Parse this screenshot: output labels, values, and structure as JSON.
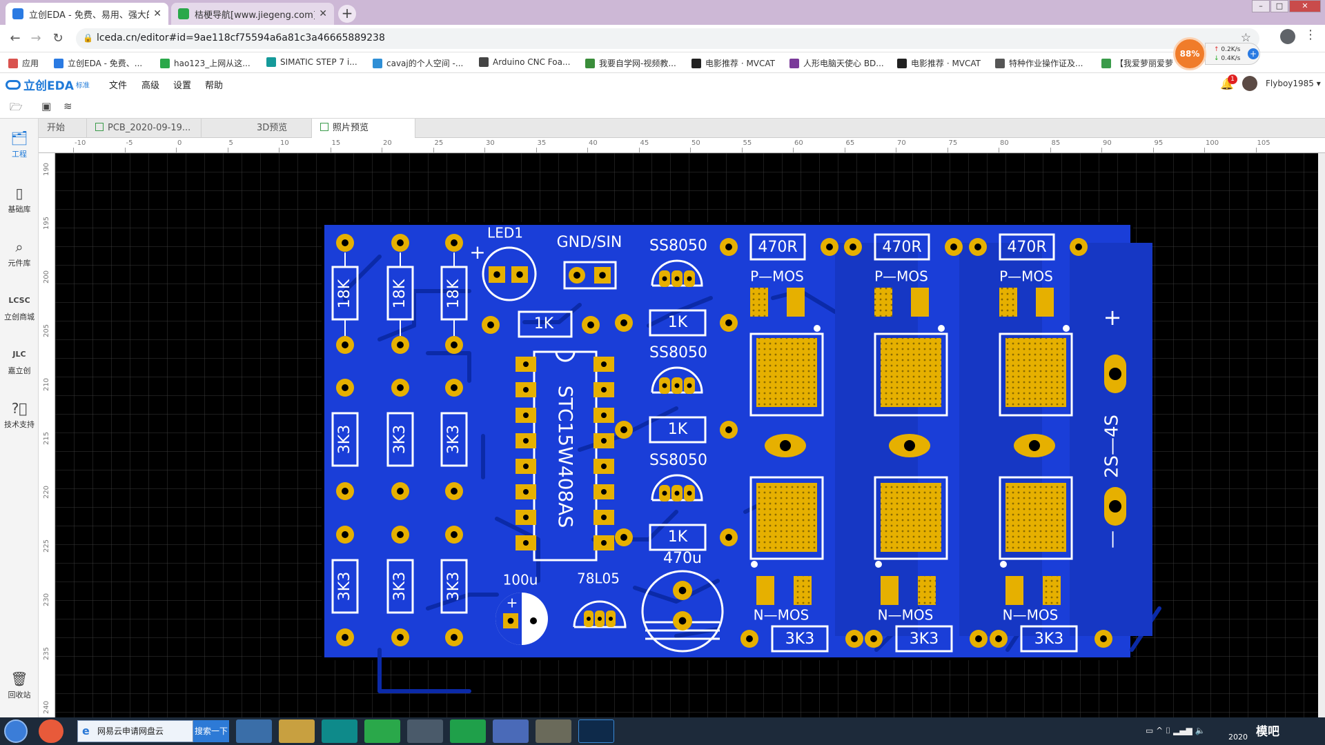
{
  "browser": {
    "tabs": [
      {
        "title": "立创EDA - 免费、易用、强大的",
        "active": true
      },
      {
        "title": "桔梗导航[www.jiegeng.com]_轻",
        "active": false
      }
    ],
    "new_tab": "+",
    "url": "lceda.cn/editor#id=9ae118cf75594a6a81c3a46665889238",
    "bookmarks": [
      "应用",
      "立创EDA - 免费、...",
      "hao123_上网从这...",
      "SIMATIC STEP 7 i...",
      "cavaj的个人空间 -...",
      "Arduino CNC Foa...",
      "我要自学网-视频教...",
      "电影推荐 · MVCAT",
      "人形电脑天使心 BD...",
      "电影推荐 · MVCAT",
      "特种作业操作证及...",
      "【我爱萝丽爱萝"
    ],
    "speed": {
      "percent": "88%",
      "up": "0.2K/s",
      "down": "0.4K/s"
    }
  },
  "app": {
    "logo": "立创EDA",
    "edition": "标准",
    "menu": [
      "文件",
      "高级",
      "设置",
      "帮助"
    ],
    "notifications": "1",
    "user": "Flyboy1985"
  },
  "sidebar": [
    {
      "label": "工程",
      "icon": "folder-icon",
      "active": true
    },
    {
      "label": "基础库",
      "icon": "chip-icon"
    },
    {
      "label": "元件库",
      "icon": "search-icon"
    },
    {
      "label": "立创商城",
      "icon": "lcsc-icon"
    },
    {
      "label": "嘉立创",
      "icon": "jlc-icon"
    },
    {
      "label": "技术支持",
      "icon": "help-icon"
    },
    {
      "label": "回收站",
      "icon": "trash-icon"
    }
  ],
  "doc_tabs": [
    "开始",
    "PCB_2020-09-19...",
    "3D预览",
    "照片预览"
  ],
  "ruler_h": [
    "-10",
    "-5",
    "0",
    "5",
    "10",
    "15",
    "20",
    "25",
    "30",
    "35",
    "40",
    "45",
    "50",
    "55",
    "60",
    "65",
    "70",
    "75",
    "80",
    "85",
    "90",
    "95",
    "100",
    "105"
  ],
  "ruler_v": [
    "190",
    "195",
    "200",
    "205",
    "210",
    "215",
    "220",
    "225",
    "230",
    "235",
    "240"
  ],
  "pcb": {
    "board_color": "#1a3ed8",
    "pad_color": "#e6b000",
    "silk_color": "#ffffff",
    "labels": {
      "led1": "LED1",
      "gnd_sin": "GND/SIN",
      "ss1": "SS8050",
      "ss2": "SS8050",
      "ss3": "SS8050",
      "r_470_1": "470R",
      "r_470_2": "470R",
      "r_470_3": "470R",
      "pmos1": "P—MOS",
      "pmos2": "P—MOS",
      "pmos3": "P—MOS",
      "nmos1": "N—MOS",
      "nmos2": "N—MOS",
      "nmos3": "N—MOS",
      "r1k_a": "1K",
      "r1k_b": "1K",
      "r1k_c": "1K",
      "r1k_d": "1K",
      "r18k_1": "18K",
      "r18k_2": "18K",
      "r18k_3": "18K",
      "r3k3_1": "3K3",
      "r3k3_2": "3K3",
      "r3k3_3": "3K3",
      "r3k3_4": "3K3",
      "r3k3_5": "3K3",
      "r3k3_6": "3K3",
      "r3k3_7": "3K3",
      "r3k3_8": "3K3",
      "r3k3_9": "3K3",
      "ic": "STC15W408AS",
      "c100": "100u",
      "reg": "78L05",
      "c470": "470u",
      "batt": "2S—4S",
      "plus": "+",
      "plus2": "+",
      "minus": "—"
    }
  },
  "taskbar": {
    "window_title": "网易云申请网盘云",
    "search_button": "搜索一下",
    "year": "2020",
    "watermark": "模吧"
  }
}
